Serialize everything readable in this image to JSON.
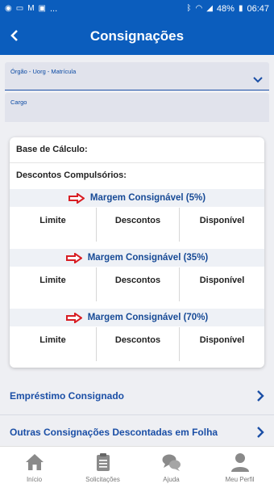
{
  "status_bar": {
    "battery": "48%",
    "time": "06:47",
    "dots": "..."
  },
  "appbar": {
    "title": "Consignações"
  },
  "form": {
    "orgao_label": "Órgão - Uorg - Matrícula",
    "cargo_label": "Cargo"
  },
  "card": {
    "base_label": "Base de Cálculo:",
    "descontos_label": "Descontos Compulsórios:",
    "margins": [
      {
        "title": "Margem Consignável (5%)",
        "cols": [
          "Limite",
          "Descontos",
          "Disponível"
        ]
      },
      {
        "title": "Margem Consignável (35%)",
        "cols": [
          "Limite",
          "Descontos",
          "Disponível"
        ]
      },
      {
        "title": "Margem Consignável (70%)",
        "cols": [
          "Limite",
          "Descontos",
          "Disponível"
        ]
      }
    ]
  },
  "links": [
    {
      "label": "Empréstimo Consignado"
    },
    {
      "label": "Outras Consignações Descontadas em Folha"
    }
  ],
  "bottom_nav": [
    {
      "label": "Início",
      "icon": "home-icon"
    },
    {
      "label": "Solicitações",
      "icon": "clipboard-icon"
    },
    {
      "label": "Ajuda",
      "icon": "chat-icon"
    },
    {
      "label": "Meu Perfil",
      "icon": "user-icon"
    }
  ],
  "colors": {
    "primary": "#0b5dbd",
    "link": "#1b4fa6",
    "arrow": "#d81e24"
  }
}
